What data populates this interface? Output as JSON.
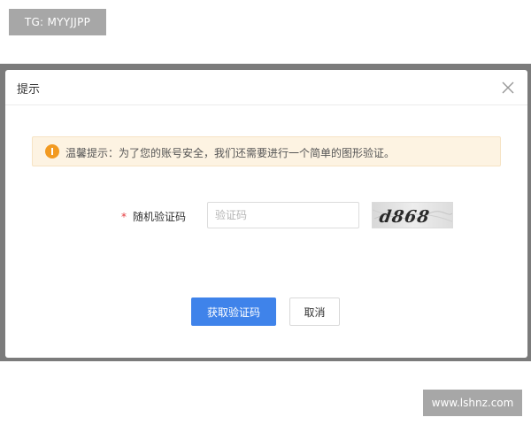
{
  "watermarks": {
    "top": "TG: MYYJJPP",
    "bottom": "www.lshnz.com"
  },
  "dialog": {
    "title": "提示",
    "notice": "温馨提示：为了您的账号安全，我们还需要进行一个简单的图形验证。",
    "form": {
      "required_mark": "*",
      "label": "随机验证码",
      "input_value": "",
      "input_placeholder": "验证码",
      "captcha_text": "d868"
    },
    "buttons": {
      "confirm": "获取验证码",
      "cancel": "取消"
    }
  },
  "colors": {
    "primary": "#3f83ea",
    "warning": "#f29a21",
    "notice_bg": "#fdf3e2",
    "required": "#e4393c"
  },
  "icons": {
    "close": "close-icon",
    "notice": "warning-icon"
  }
}
